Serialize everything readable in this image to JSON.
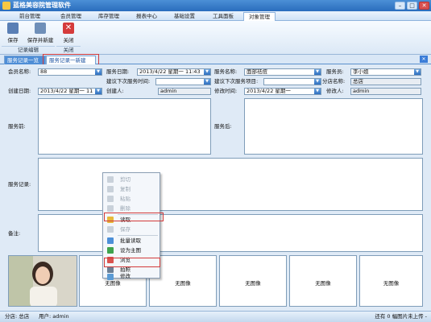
{
  "window": {
    "title": "蓝格美容院管理软件",
    "min": "–",
    "max": "□",
    "close": "✕"
  },
  "menu": {
    "tabs": [
      "前台管理",
      "会员管理",
      "库存管理",
      "报表中心",
      "基础设置",
      "工具面板",
      "对象管理"
    ],
    "active_index": 6
  },
  "ribbon": {
    "buttons": [
      {
        "label": "保存",
        "icon": "save-icon"
      },
      {
        "label": "保存并新建",
        "icon": "save-new-icon"
      },
      {
        "label": "关闭",
        "icon": "close-red-icon"
      }
    ],
    "groups": [
      "记录编辑",
      "关闭"
    ]
  },
  "doctabs": {
    "tabs": [
      "服务记录一览",
      "服务记录一新建"
    ],
    "close": "✕"
  },
  "form": {
    "member_name_label": "会员名称:",
    "member_name_value": "88",
    "service_date_label": "服务日期:",
    "service_date_value": "2013/4/22 星期一 11:43",
    "service_name_label": "服务名称:",
    "service_name_value": "面部祛痘",
    "staff_label": "服务员:",
    "staff_value": "李小姐",
    "next_time_label": "建议下次服务时间:",
    "next_time_value": "",
    "next_item_label": "建议下次服务项目:",
    "next_item_value": "",
    "branch_label": "分店名称:",
    "branch_value": "总店",
    "create_date_label": "创建日期:",
    "create_date_value": "2013/4/22 星期一 11",
    "creator_label": "创建人:",
    "creator_value": "admin",
    "modify_time_label": "修改时间:",
    "modify_time_value": "2013/4/22 星期一",
    "modifier_label": "修改人:",
    "modifier_value": "admin",
    "before_label": "服务前:",
    "after_label": "服务后:",
    "record_label": "服务记录:",
    "notes_label": "备注:"
  },
  "photos": {
    "no_image": "无图像"
  },
  "context_menu": {
    "items": [
      {
        "label": "剪切",
        "enabled": false,
        "icon": "cut-icon"
      },
      {
        "label": "复制",
        "enabled": false,
        "icon": "copy-icon"
      },
      {
        "label": "粘贴",
        "enabled": false,
        "icon": "paste-icon"
      },
      {
        "label": "删除",
        "enabled": false,
        "icon": "delete-icon"
      },
      {
        "label": "读取",
        "enabled": true,
        "icon": "folder-open-icon"
      },
      {
        "label": "保存",
        "enabled": false,
        "icon": "save-icon"
      },
      {
        "label": "批量读取",
        "enabled": true,
        "icon": "batch-read-icon"
      },
      {
        "label": "设为主图",
        "enabled": true,
        "icon": "set-main-image-icon"
      },
      {
        "label": "浏览",
        "enabled": true,
        "icon": "browse-icon"
      },
      {
        "label": "拍照",
        "enabled": true,
        "icon": "camera-icon"
      },
      {
        "label": "修改",
        "enabled": true,
        "icon": "edit-icon"
      }
    ]
  },
  "status": {
    "branch": "分店: 总店",
    "user": "用户: admin",
    "upload": "还有 0 幅图片未上传 -"
  },
  "colors": {
    "titlebar": "#2a6dbd",
    "highlight": "#d23a3a",
    "accent": "#3b7dd8"
  }
}
